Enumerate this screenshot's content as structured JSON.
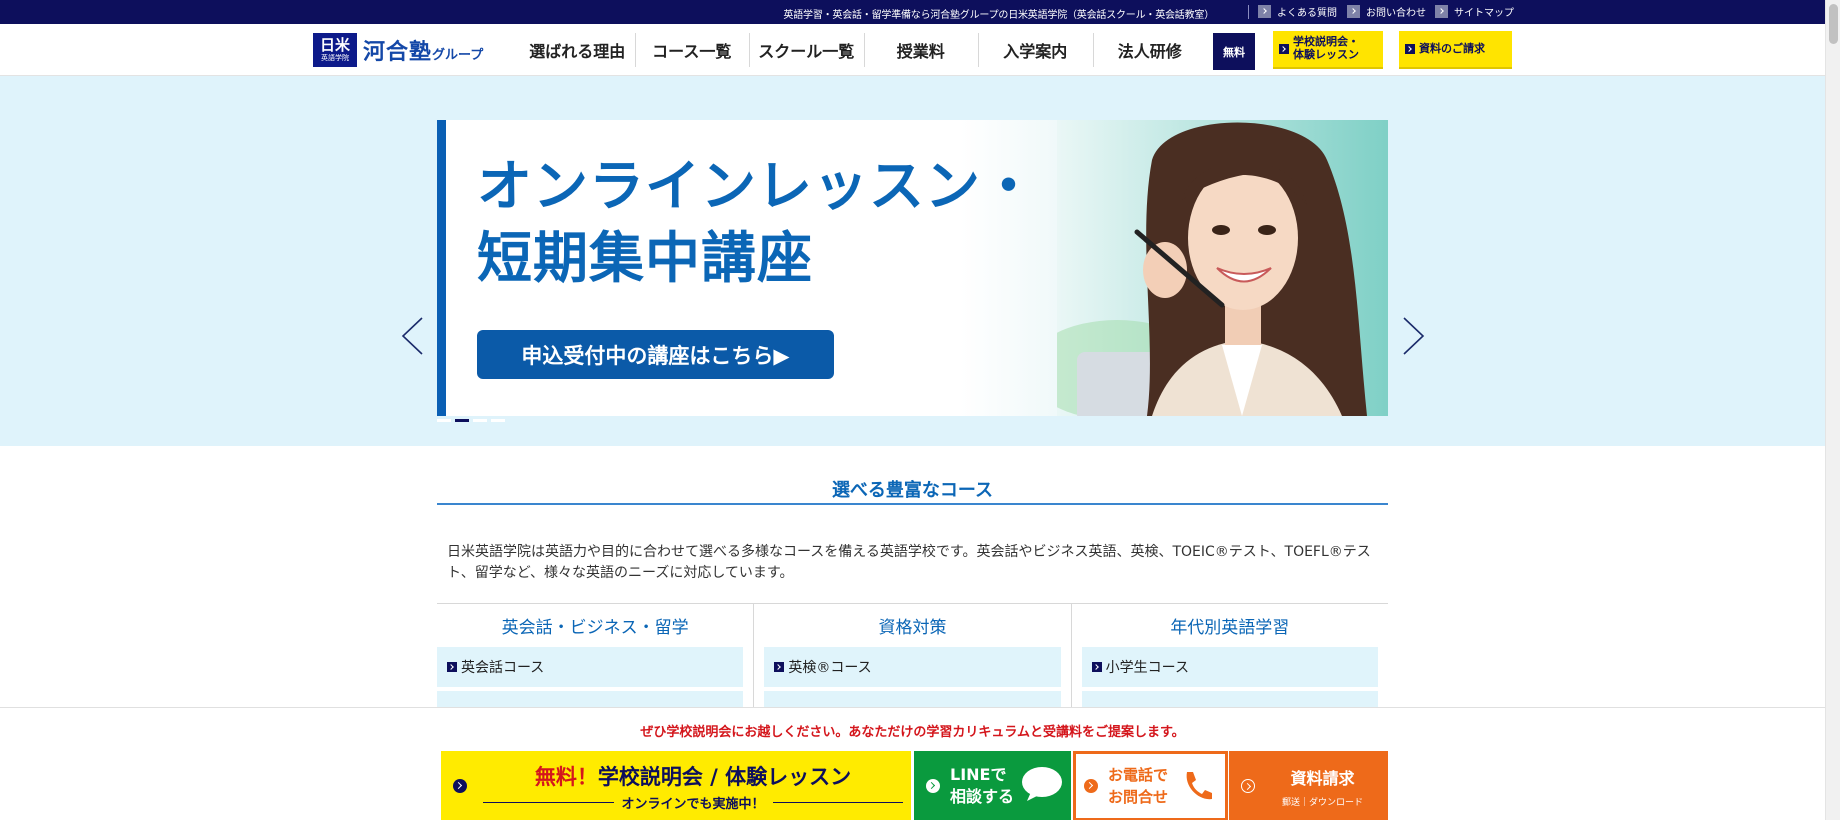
{
  "topbar": {
    "tagline": "英語学習・英会話・留学準備なら河合塾グループの日米英語学院（英会話スクール・英会話教室）",
    "links": [
      "よくある質問",
      "お問い合わせ",
      "サイトマップ"
    ]
  },
  "header": {
    "logo_badge": "日米",
    "logo_badge_small": "英語学院",
    "logo_wordmark": "河合塾",
    "logo_wordmark_sub": "グループ",
    "nav": [
      "選ばれる理由",
      "コース一覧",
      "スクール一覧",
      "授業料",
      "入学案内",
      "法人研修"
    ],
    "free_tag": "無料",
    "btn_seminar_line1": "学校説明会・",
    "btn_seminar_line2": "体験レッスン",
    "btn_request": "資料のご請求"
  },
  "hero": {
    "title_line1": "オンラインレッスン・",
    "title_line2": "短期集中講座",
    "cta": "申込受付中の講座はこちら▶",
    "slide_count": 4,
    "active_slide": 2
  },
  "courses": {
    "title": "選べる豊富なコース",
    "intro": "日米英語学院は英語力や目的に合わせて選べる多様なコースを備える英語学校です。英会話やビジネス英語、英検、TOEIC®テスト、TOEFL®テスト、留学など、様々な英語のニーズに対応しています。",
    "columns": [
      {
        "title": "英会話・ビジネス・留学",
        "items": [
          "英会話コース"
        ]
      },
      {
        "title": "資格対策",
        "items": [
          "英検®コース"
        ]
      },
      {
        "title": "年代別英語学習",
        "items": [
          "小学生コース"
        ]
      }
    ]
  },
  "sticky": {
    "message": "ぜひ学校説明会にお越しください。あなただけの学習カリキュラムと受講料をご提案します。",
    "seminar_free": "無料！",
    "seminar_main": "学校説明会 / 体験レッスン",
    "seminar_sub": "オンラインでも実施中！",
    "line_line1": "LINEで",
    "line_line2": "相談する",
    "phone_line1": "お電話で",
    "phone_line2": "お問合せ",
    "request_main": "資料請求",
    "request_sub": "郵送｜ダウンロード"
  },
  "colors": {
    "navy": "#0d0f5c",
    "brand_blue": "#0b66b6",
    "yellow": "#ffe400",
    "line_green": "#0a9a3e",
    "orange": "#ee6a1a",
    "red": "#d4161c",
    "hero_bg": "#dff3fb"
  }
}
